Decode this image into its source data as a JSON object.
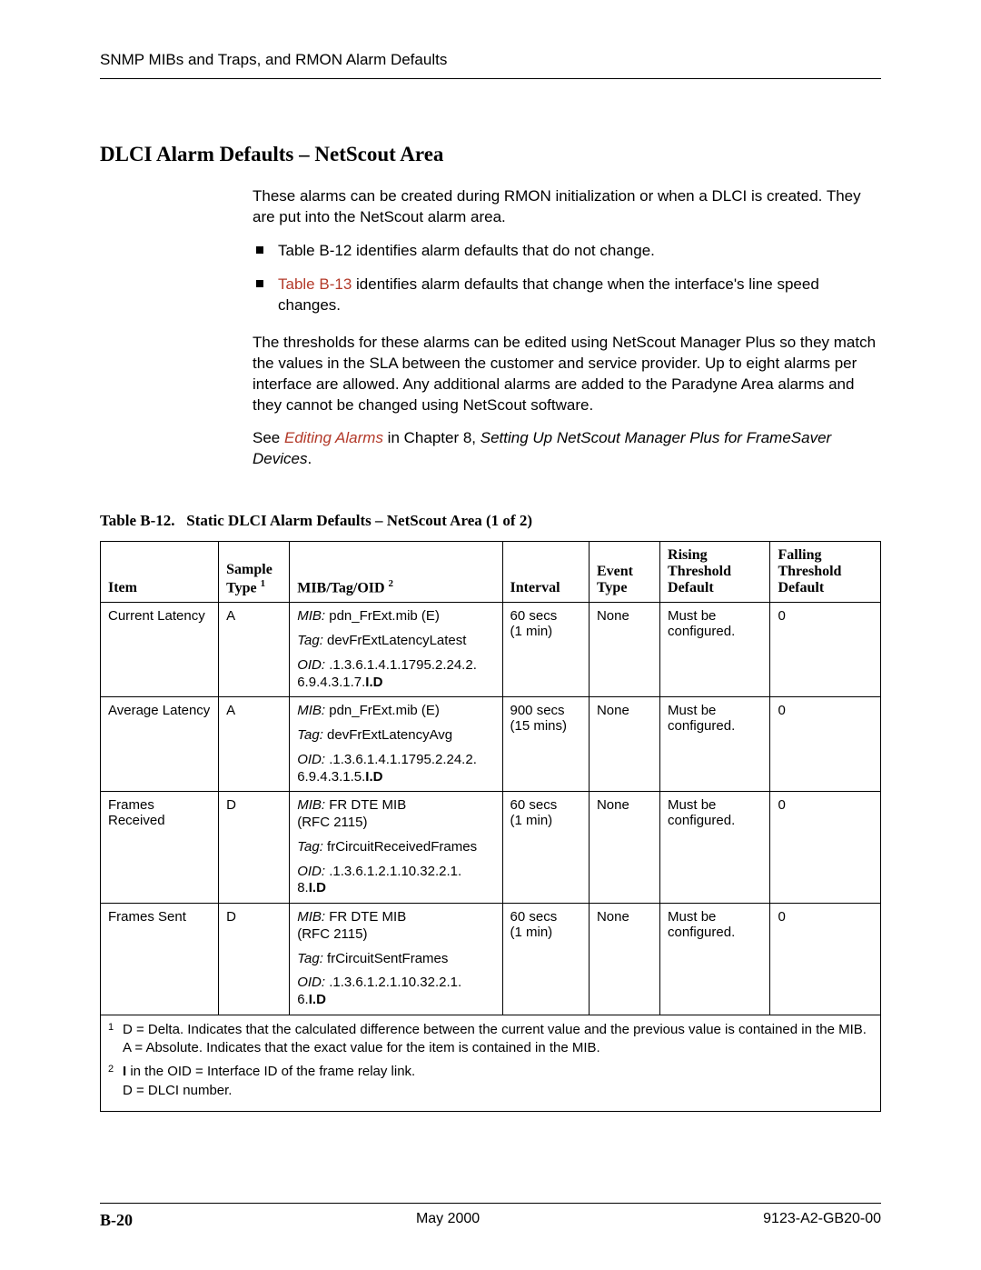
{
  "header": {
    "text": "SNMP MIBs and Traps, and RMON Alarm Defaults"
  },
  "section": {
    "title": "DLCI Alarm Defaults – NetScout Area"
  },
  "intro": {
    "p1": "These alarms can be created during RMON initialization or when a DLCI is created. They are put into the NetScout alarm area.",
    "b1": "Table B-12 identifies alarm defaults that do not change.",
    "b2_link": "Table B-13",
    "b2_rest": " identifies alarm defaults that change when the interface's line speed changes.",
    "p2": "The thresholds for these alarms can be edited using NetScout Manager Plus so they match the values in the SLA between the customer and service provider. Up to eight alarms per interface are allowed. Any additional alarms are added to the Paradyne Area alarms and they cannot be changed using NetScout software.",
    "p3_pre": "See ",
    "p3_link": "Editing Alarms",
    "p3_mid": " in Chapter 8, ",
    "p3_ital": "Setting Up NetScout Manager Plus for FrameSaver Devices",
    "p3_end": "."
  },
  "table": {
    "caption_prefix": "Table B-12.",
    "caption_title": "Static DLCI Alarm Defaults – NetScout Area (1 of 2)",
    "headers": {
      "item": "Item",
      "sample_l1": "Sample",
      "sample_l2_pre": "Type ",
      "sample_sup": "1",
      "mib_pre": "MIB/Tag/OID ",
      "mib_sup": "2",
      "interval": "Interval",
      "event_l1": "Event",
      "event_l2": "Type",
      "rising_l1": "Rising",
      "rising_l2": "Threshold",
      "rising_l3": "Default",
      "falling_l1": "Falling",
      "falling_l2": "Threshold",
      "falling_l3": "Default"
    },
    "labels": {
      "mib": "MIB:",
      "tag": "Tag:",
      "oid": "OID:"
    },
    "rows": [
      {
        "item": "Current Latency",
        "sample": "A",
        "mib": " pdn_FrExt.mib (E)",
        "tag": " devFrExtLatencyLatest",
        "oid_pre": " .1.3.6.1.4.1.1795.2.24.2.\n6.9.4.3.1.7.",
        "oid_bold": "I.D",
        "interval_l1": "60 secs",
        "interval_l2": "(1 min)",
        "event": "None",
        "rising_l1": "Must be",
        "rising_l2": "configured.",
        "falling": "0"
      },
      {
        "item": "Average Latency",
        "sample": "A",
        "mib": " pdn_FrExt.mib (E)",
        "tag": " devFrExtLatencyAvg",
        "oid_pre": " .1.3.6.1.4.1.1795.2.24.2.\n6.9.4.3.1.5.",
        "oid_bold": "I.D",
        "interval_l1": "900 secs",
        "interval_l2": "(15 mins)",
        "event": "None",
        "rising_l1": "Must be",
        "rising_l2": "configured.",
        "falling": "0"
      },
      {
        "item": "Frames Received",
        "sample": "D",
        "mib": " FR DTE MIB\n(RFC 2115)",
        "tag": " frCircuitReceivedFrames",
        "oid_pre": " .1.3.6.1.2.1.10.32.2.1.\n8.",
        "oid_bold": "I.D",
        "interval_l1": "60 secs",
        "interval_l2": "(1 min)",
        "event": "None",
        "rising_l1": "Must be",
        "rising_l2": "configured.",
        "falling": "0"
      },
      {
        "item": "Frames Sent",
        "sample": "D",
        "mib": " FR DTE MIB\n(RFC 2115)",
        "tag": " frCircuitSentFrames",
        "oid_pre": " .1.3.6.1.2.1.10.32.2.1.\n6.",
        "oid_bold": "I.D",
        "interval_l1": "60 secs",
        "interval_l2": "(1 min)",
        "event": "None",
        "rising_l1": "Must be",
        "rising_l2": "configured.",
        "falling": "0"
      }
    ],
    "footnotes": {
      "f1_num": "1",
      "f1_l1": "D = Delta. Indicates that the calculated difference between the current value and the previous value is contained in the MIB.",
      "f1_l2": "A = Absolute. Indicates that the exact value for the item is contained in the MIB.",
      "f2_num": "2",
      "f2_bold": "I",
      "f2_l1_rest": " in the OID = Interface ID of the frame relay link.",
      "f2_l2": "D = DLCI number."
    }
  },
  "footer": {
    "page_num": "B-20",
    "date": "May 2000",
    "doc_id": "9123-A2-GB20-00"
  }
}
